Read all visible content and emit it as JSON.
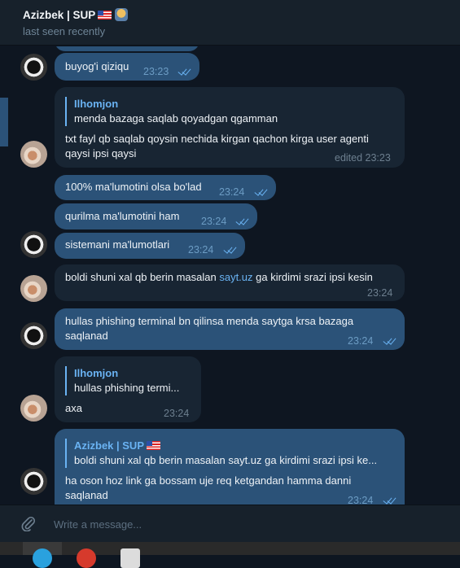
{
  "header": {
    "title": "Azizbek | SUP",
    "status": "last seen recently"
  },
  "input": {
    "placeholder": "Write a message..."
  },
  "messages": [
    {
      "text": "buyog'i qiziqu",
      "time": "23:23"
    },
    {
      "reply_name": "Ilhomjon",
      "reply_text": "menda bazaga saqlab qoyadgan qgamman",
      "line1": "txt fayl qb saqlab qoysin nechida kirgan qachon kirga user agenti",
      "line2": "qaysi ipsi qaysi",
      "edited": "edited 23:23"
    },
    {
      "text": "100% ma'lumotini olsa bo'lad",
      "time": "23:24"
    },
    {
      "text": "qurilma ma'lumotini ham",
      "time": "23:24"
    },
    {
      "text": "sistemani ma'lumotlari",
      "time": "23:24"
    },
    {
      "pre": "boldi shuni xal qb berin masalan ",
      "link": "sayt.uz",
      "post": " ga kirdimi srazi ipsi kesin",
      "time": "23:24"
    },
    {
      "line1": "hullas phishing terminal bn qilinsa menda saytga krsa bazaga",
      "line2": "saqlanad",
      "time": "23:24"
    },
    {
      "reply_name": "Ilhomjon",
      "reply_text": "hullas phishing termi...",
      "text": "axa",
      "time": "23:24"
    },
    {
      "reply_name": "Azizbek | SUP",
      "reply_text": "boldi shuni xal qb berin masalan sayt.uz ga kirdimi srazi ipsi ke...",
      "line1": "ha oson hoz link ga bossam uje req ketgandan hamma danni",
      "line2": "saqlanad",
      "time": "23:24"
    }
  ],
  "icons": {
    "attach": "paperclip-icon",
    "double_check": "double-check-icon"
  },
  "colors": {
    "bg": "#0e1621",
    "outgoing": "#2b5278",
    "incoming": "#182533",
    "accent": "#6ab3f3"
  }
}
